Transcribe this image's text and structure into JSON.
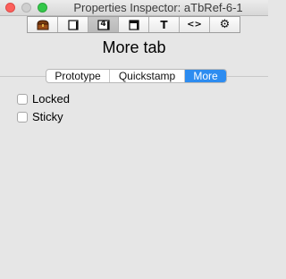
{
  "window": {
    "title": "Properties Inspector: aTbRef-6-1"
  },
  "toolbar": {
    "buttons": [
      {
        "icon": "treasure-chest-icon",
        "glyph": ""
      },
      {
        "icon": "note-icon",
        "glyph": ""
      },
      {
        "icon": "number-icon",
        "glyph": "4",
        "selected": true
      },
      {
        "icon": "window-icon",
        "glyph": ""
      },
      {
        "icon": "text-icon",
        "glyph": "T"
      },
      {
        "icon": "code-icon",
        "glyph": "<>"
      },
      {
        "icon": "gear-icon",
        "glyph": "⚙"
      }
    ]
  },
  "heading": "More tab",
  "tabs": [
    {
      "label": "Prototype",
      "active": false
    },
    {
      "label": "Quickstamp",
      "active": false
    },
    {
      "label": "More",
      "active": true
    }
  ],
  "options": [
    {
      "label": "Locked",
      "checked": false
    },
    {
      "label": "Sticky",
      "checked": false
    }
  ],
  "colors": {
    "accent": "#2d8cf0"
  }
}
